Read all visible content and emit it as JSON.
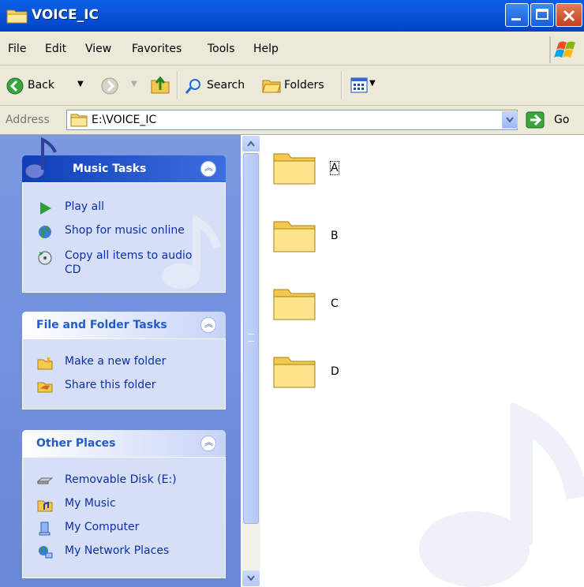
{
  "window": {
    "title": "VOICE_IC"
  },
  "menu": {
    "items": [
      "File",
      "Edit",
      "View",
      "Favorites",
      "Tools",
      "Help"
    ]
  },
  "toolbar": {
    "back_label": "Back",
    "search_label": "Search",
    "folders_label": "Folders"
  },
  "address": {
    "label": "Address",
    "value": "E:\\VOICE_IC",
    "go_label": "Go"
  },
  "taskpane": {
    "music_tasks": {
      "title": "Music Tasks",
      "items": [
        "Play all",
        "Shop for music online",
        "Copy all items to audio",
        "CD"
      ]
    },
    "file_folder_tasks": {
      "title": "File and Folder Tasks",
      "items": [
        "Make a new folder",
        "Share this folder"
      ]
    },
    "other_places": {
      "title": "Other Places",
      "items": [
        "Removable Disk (E:)",
        "My Music",
        "My Computer",
        "My Network Places"
      ]
    }
  },
  "folders": [
    "A",
    "B",
    "C",
    "D"
  ],
  "colors": {
    "titlebar": "#0a55d9",
    "link": "#0c2fa8",
    "panel_title": "#215dc6",
    "pane_bg": "#7a99e0"
  }
}
